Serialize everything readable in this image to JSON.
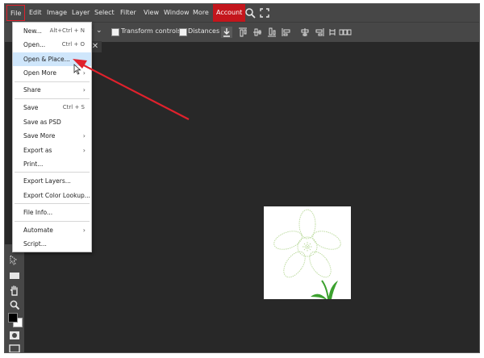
{
  "menubar": {
    "items": [
      "File",
      "Edit",
      "Image",
      "Layer",
      "Select",
      "Filter",
      "View",
      "Window",
      "More",
      "Account"
    ]
  },
  "options_bar": {
    "dropdown_partial": "er",
    "transform_controls": "Transform controls",
    "distances": "Distances"
  },
  "tab": {
    "close_glyph": "✕"
  },
  "file_menu": {
    "items": [
      {
        "label": "New...",
        "shortcut": "Alt+Ctrl + N"
      },
      {
        "label": "Open...",
        "shortcut": "Ctrl + O"
      },
      {
        "label": "Open & Place...",
        "shortcut": ""
      },
      {
        "label": "Open More",
        "shortcut": ""
      },
      {
        "label": "Share",
        "shortcut": ""
      },
      {
        "label": "Save",
        "shortcut": "Ctrl + S"
      },
      {
        "label": "Save as PSD",
        "shortcut": ""
      },
      {
        "label": "Save More",
        "shortcut": ""
      },
      {
        "label": "Export as",
        "shortcut": ""
      },
      {
        "label": "Print...",
        "shortcut": ""
      },
      {
        "label": "Export Layers...",
        "shortcut": ""
      },
      {
        "label": "Export Color Lookup...",
        "shortcut": ""
      },
      {
        "label": "File Info...",
        "shortcut": ""
      },
      {
        "label": "Automate",
        "shortcut": ""
      },
      {
        "label": "Script...",
        "shortcut": ""
      }
    ],
    "highlighted": "Open & Place...",
    "submenu_arrow": "›"
  },
  "colors": {
    "accent_red": "#c4161c",
    "annotation_arrow": "#e0212c",
    "highlight": "#cfe6fb"
  },
  "icons": {
    "menubar": [
      "search-icon",
      "fullscreen-icon"
    ],
    "options_bar": [
      "download-icon",
      "align-icons",
      "distribute-icons"
    ],
    "toolbar": [
      "select-tool-icon",
      "rectangle-tool-icon",
      "hand-tool-icon",
      "zoom-tool-icon",
      "color-swatch-icon",
      "quick-mask-icon",
      "screen-mode-icon"
    ]
  }
}
